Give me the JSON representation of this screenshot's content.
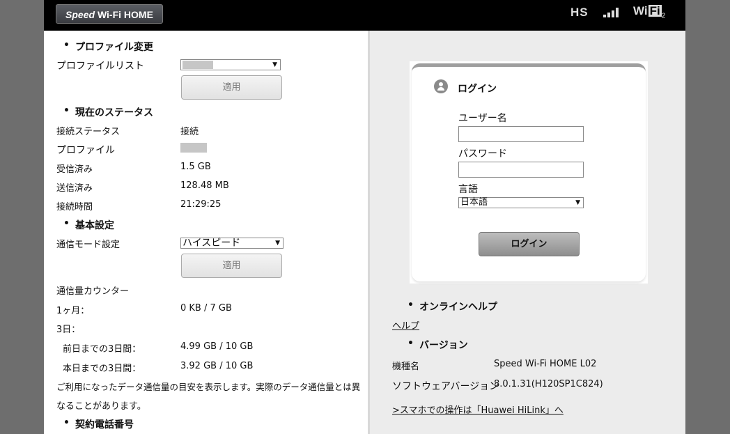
{
  "header": {
    "logo_prefix": "Speed",
    "logo_suffix": "Wi-Fi HOME",
    "network_mode": "HS",
    "wifi_label": "Wi",
    "wifi_box": "Fi",
    "wifi_count": "2"
  },
  "left": {
    "profile_change": {
      "title": "プロファイル変更",
      "list_label": "プロファイルリスト",
      "apply": "適用"
    },
    "status": {
      "title": "現在のステータス",
      "rows": [
        {
          "label": "接続ステータス",
          "value": "接続"
        },
        {
          "label": "プロファイル",
          "value": ""
        },
        {
          "label": "受信済み",
          "value": "1.5 GB"
        },
        {
          "label": "送信済み",
          "value": "128.48 MB"
        },
        {
          "label": "接続時間",
          "value": "21:29:25"
        }
      ]
    },
    "basic": {
      "title": "基本設定",
      "mode_label": "通信モード設定",
      "mode_value": "ハイスピード",
      "apply": "適用",
      "counter_label": "通信量カウンター",
      "month_label": "1ヶ月：",
      "month_value": "0 KB / 7 GB",
      "three_day_label": "3日：",
      "prev_label": "前日までの3日間：",
      "prev_value": "4.99 GB / 10 GB",
      "today_label": "本日までの3日間：",
      "today_value": "3.92 GB / 10 GB",
      "note_line1": "ご利用になったデータ通信量の目安を表示します。実際のデータ通信量とは異",
      "note_line2": "なることがあります。"
    },
    "contract": {
      "title": "契約電話番号"
    }
  },
  "login": {
    "title": "ログイン",
    "username_label": "ユーザー名",
    "password_label": "パスワード",
    "language_label": "言語",
    "language_value": "日本語",
    "button": "ログイン"
  },
  "right": {
    "online_help_title": "オンラインヘルプ",
    "help_link": "ヘルプ",
    "version_title": "バージョン",
    "model_label": "機種名",
    "model_value": "Speed Wi-Fi HOME L02",
    "software_label": "ソフトウェアバージョン",
    "software_value": "8.0.1.31(H120SP1C824)",
    "hilink_link": ">スマホでの操作は「Huawei HiLink」へ"
  }
}
